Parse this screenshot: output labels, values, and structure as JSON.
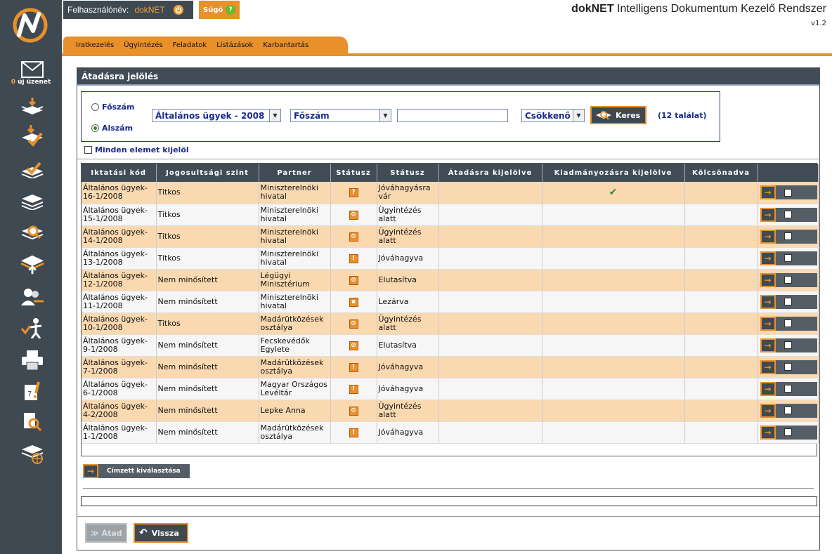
{
  "header": {
    "user_label": "Felhasználónév:",
    "user_name": "dokNET",
    "help_label": "Súgó",
    "app_title_bold": "dokNET",
    "app_title_rest": " Intelligens Dokumentum Kezelő Rendszer",
    "version": "v1.2"
  },
  "sidebar": {
    "message_count": "0",
    "message_label": " új üzenet"
  },
  "menu": {
    "items": [
      "Iratkezelés",
      "Ügyintézés",
      "Feladatok",
      "Listázások",
      "Karbantartás"
    ]
  },
  "panel": {
    "title": "Átadásra jelölés"
  },
  "search": {
    "radio_foszam": "Főszám",
    "radio_alszam": "Alszám",
    "selected_radio": "Alszám",
    "category_select": "Általános ügyek - 2008",
    "field_select": "Főszám",
    "search_value": "",
    "order_select": "Csökkenő",
    "search_button": "Keres",
    "result_count": "(12 találat)"
  },
  "select_all_label": "Minden elemet kijelöl",
  "table": {
    "columns": [
      "Iktatási kód",
      "Jogosultsági szint",
      "Partner",
      "Státusz",
      "Státusz",
      "Átadásra kijelölve",
      "Kiadmányozásra kijelölve",
      "Kölcsönadva",
      ""
    ],
    "rows": [
      {
        "code": "Általános ügyek-16-1/2008",
        "level": "Titkos",
        "partner": "Miniszterelnöki hivatal",
        "status_icon": "?",
        "status": "Jóváhagyásra vár",
        "handover": "",
        "signing": "✔",
        "loaned": ""
      },
      {
        "code": "Általános ügyek-15-1/2008",
        "level": "Titkos",
        "partner": "Miniszterelnöki hivatal",
        "status_icon": "⚙",
        "status": "Ügyintézés alatt",
        "handover": "",
        "signing": "",
        "loaned": ""
      },
      {
        "code": "Általános ügyek-14-1/2008",
        "level": "Titkos",
        "partner": "Miniszterelnöki hivatal",
        "status_icon": "⚙",
        "status": "Ügyintézés alatt",
        "handover": "",
        "signing": "",
        "loaned": ""
      },
      {
        "code": "Általános ügyek-13-1/2008",
        "level": "Titkos",
        "partner": "Miniszterelnöki hivatal",
        "status_icon": "!",
        "status": "Jóváhagyva",
        "handover": "",
        "signing": "",
        "loaned": ""
      },
      {
        "code": "Általános ügyek-12-1/2008",
        "level": "Nem minősített",
        "partner": "Légügyi Minisztérium",
        "status_icon": "⊘",
        "status": "Elutasítva",
        "handover": "",
        "signing": "",
        "loaned": ""
      },
      {
        "code": "Általános ügyek-11-1/2008",
        "level": "Nem minősített",
        "partner": "Miniszterelnöki hivatal",
        "status_icon": "▪",
        "status": "Lezárva",
        "handover": "",
        "signing": "",
        "loaned": ""
      },
      {
        "code": "Általános ügyek-10-1/2008",
        "level": "Titkos",
        "partner": "Madárütközések osztálya",
        "status_icon": "⚙",
        "status": "Ügyintézés alatt",
        "handover": "",
        "signing": "",
        "loaned": ""
      },
      {
        "code": "Általános ügyek-9-1/2008",
        "level": "Nem minősített",
        "partner": "Fecskevédők Egylete",
        "status_icon": "⊘",
        "status": "Elutasítva",
        "handover": "",
        "signing": "",
        "loaned": ""
      },
      {
        "code": "Általános ügyek-7-1/2008",
        "level": "Nem minősített",
        "partner": "Madárütközések osztálya",
        "status_icon": "!",
        "status": "Jóváhagyva",
        "handover": "",
        "signing": "",
        "loaned": ""
      },
      {
        "code": "Általános ügyek-6-1/2008",
        "level": "Nem minősített",
        "partner": "Magyar Országos Levéltár",
        "status_icon": "!",
        "status": "Jóváhagyva",
        "handover": "",
        "signing": "",
        "loaned": ""
      },
      {
        "code": "Általános ügyek-4-2/2008",
        "level": "Nem minősített",
        "partner": "Lepke Anna",
        "status_icon": "⚙",
        "status": "Ügyintézés alatt",
        "handover": "",
        "signing": "",
        "loaned": ""
      },
      {
        "code": "Általános ügyek-1-1/2008",
        "level": "Nem minősített",
        "partner": "Madárütközések osztálya",
        "status_icon": "!",
        "status": "Jóváhagyva",
        "handover": "",
        "signing": "",
        "loaned": ""
      }
    ]
  },
  "buttons": {
    "recipient": "Címzett kiválasztása",
    "handover": "Átad",
    "back": "Vissza"
  },
  "colors": {
    "accent": "#e8902a",
    "dark": "#3f4952",
    "row_highlight": "#fbd9b0"
  }
}
